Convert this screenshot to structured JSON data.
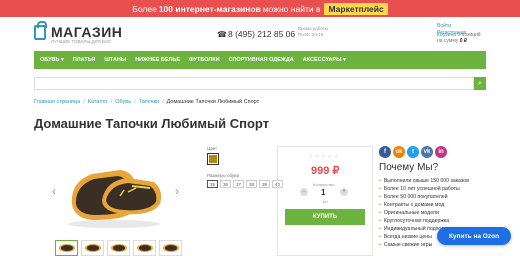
{
  "promo": {
    "text_before": "Более",
    "highlight": "100 интернет-магазинов",
    "text_after": "можно найти в",
    "marketplace": "Маркетплейс"
  },
  "header": {
    "logo_name": "МАГАЗИН",
    "logo_sub": "ЛУЧШИЕ ТОВАРЫ ДЛЯ ВАС",
    "phone": "8 (495) 212 85 06",
    "hours_label": "Время работы",
    "hours_value": "Пн-Вс 10-19",
    "login": "Войти",
    "register": "Регистрация",
    "cart_label": "Корзина",
    "cart_count": "0 позиций",
    "cart_sum_label": "на сумму",
    "cart_sum": "0 ₽"
  },
  "nav": {
    "items": [
      "ОБУВЬ",
      "ПЛАТЬЯ",
      "ШТАНЫ",
      "НИЖНЕЕ БЕЛЬЕ",
      "ФУТБОЛКИ",
      "СПОРТИВНАЯ ОДЕЖДА",
      "АКСЕССУАРЫ"
    ]
  },
  "search": {
    "placeholder": ""
  },
  "breadcrumbs": [
    "Главная страница",
    "Каталог",
    "Обувь",
    "Тапочки",
    "Домашние Тапочки Любимый Спорт"
  ],
  "product": {
    "title": "Домашние Тапочки Любимый Спорт",
    "color_label": "Цвет",
    "color_value": "#b8860b",
    "size_label": "Размеры обуви",
    "sizes": [
      "35",
      "36",
      "37",
      "38",
      "39",
      "40"
    ],
    "selected_size": "35",
    "price": "999 ₽",
    "qty_label": "Количество",
    "qty": "1",
    "qty_unit": "шт",
    "buy_label": "КУПИТЬ"
  },
  "social": [
    {
      "icon": "facebook-icon",
      "glyph": "f",
      "color": "#3b5998"
    },
    {
      "icon": "odnoklassniki-icon",
      "glyph": "ok",
      "color": "#ee8208"
    },
    {
      "icon": "twitter-icon",
      "glyph": "t",
      "color": "#1da1f2"
    },
    {
      "icon": "vk-icon",
      "glyph": "vk",
      "color": "#4a76a8"
    },
    {
      "icon": "instagram-icon",
      "glyph": "in",
      "color": "#c13584"
    }
  ],
  "why": {
    "title": "Почему Мы?",
    "reasons": [
      "Выполнили свыше 150 000 заказов",
      "Более 10 лет успешной работы",
      "Более 50 000 покупателей",
      "Контракты с домами мод",
      "Оригинальные модели",
      "Круглосуточная поддержка",
      "Индивидуальный подход",
      "Всегда низкие цены",
      "Самые свежие игры"
    ]
  },
  "ozon_button": "Купить на Ozon",
  "colors": {
    "accent_green": "#6db33f",
    "promo_red": "#e94f4f",
    "link_blue": "#2e9ab4",
    "ozon_blue": "#1e6fe6"
  }
}
